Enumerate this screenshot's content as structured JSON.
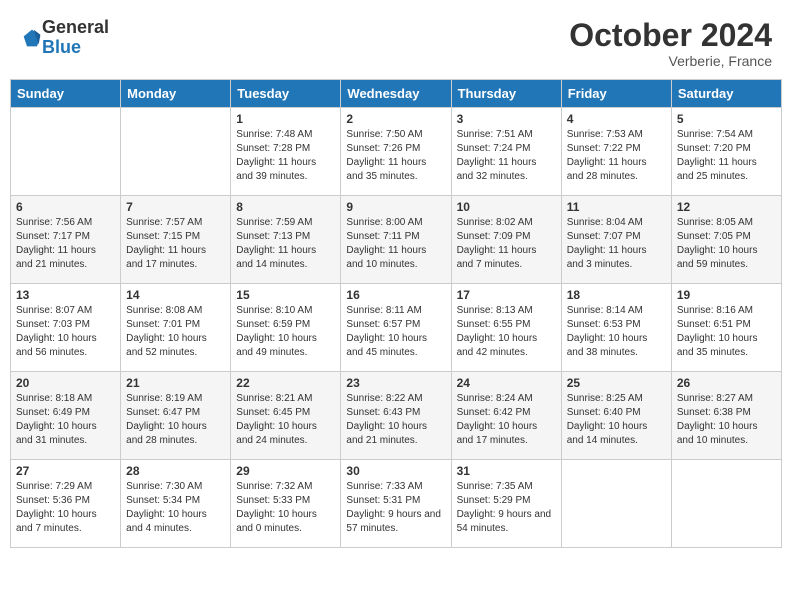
{
  "logo": {
    "general": "General",
    "blue": "Blue"
  },
  "title": {
    "month": "October 2024",
    "location": "Verberie, France"
  },
  "days_of_week": [
    "Sunday",
    "Monday",
    "Tuesday",
    "Wednesday",
    "Thursday",
    "Friday",
    "Saturday"
  ],
  "weeks": [
    [
      {
        "day": "",
        "info": ""
      },
      {
        "day": "",
        "info": ""
      },
      {
        "day": "1",
        "info": "Sunrise: 7:48 AM\nSunset: 7:28 PM\nDaylight: 11 hours and 39 minutes."
      },
      {
        "day": "2",
        "info": "Sunrise: 7:50 AM\nSunset: 7:26 PM\nDaylight: 11 hours and 35 minutes."
      },
      {
        "day": "3",
        "info": "Sunrise: 7:51 AM\nSunset: 7:24 PM\nDaylight: 11 hours and 32 minutes."
      },
      {
        "day": "4",
        "info": "Sunrise: 7:53 AM\nSunset: 7:22 PM\nDaylight: 11 hours and 28 minutes."
      },
      {
        "day": "5",
        "info": "Sunrise: 7:54 AM\nSunset: 7:20 PM\nDaylight: 11 hours and 25 minutes."
      }
    ],
    [
      {
        "day": "6",
        "info": "Sunrise: 7:56 AM\nSunset: 7:17 PM\nDaylight: 11 hours and 21 minutes."
      },
      {
        "day": "7",
        "info": "Sunrise: 7:57 AM\nSunset: 7:15 PM\nDaylight: 11 hours and 17 minutes."
      },
      {
        "day": "8",
        "info": "Sunrise: 7:59 AM\nSunset: 7:13 PM\nDaylight: 11 hours and 14 minutes."
      },
      {
        "day": "9",
        "info": "Sunrise: 8:00 AM\nSunset: 7:11 PM\nDaylight: 11 hours and 10 minutes."
      },
      {
        "day": "10",
        "info": "Sunrise: 8:02 AM\nSunset: 7:09 PM\nDaylight: 11 hours and 7 minutes."
      },
      {
        "day": "11",
        "info": "Sunrise: 8:04 AM\nSunset: 7:07 PM\nDaylight: 11 hours and 3 minutes."
      },
      {
        "day": "12",
        "info": "Sunrise: 8:05 AM\nSunset: 7:05 PM\nDaylight: 10 hours and 59 minutes."
      }
    ],
    [
      {
        "day": "13",
        "info": "Sunrise: 8:07 AM\nSunset: 7:03 PM\nDaylight: 10 hours and 56 minutes."
      },
      {
        "day": "14",
        "info": "Sunrise: 8:08 AM\nSunset: 7:01 PM\nDaylight: 10 hours and 52 minutes."
      },
      {
        "day": "15",
        "info": "Sunrise: 8:10 AM\nSunset: 6:59 PM\nDaylight: 10 hours and 49 minutes."
      },
      {
        "day": "16",
        "info": "Sunrise: 8:11 AM\nSunset: 6:57 PM\nDaylight: 10 hours and 45 minutes."
      },
      {
        "day": "17",
        "info": "Sunrise: 8:13 AM\nSunset: 6:55 PM\nDaylight: 10 hours and 42 minutes."
      },
      {
        "day": "18",
        "info": "Sunrise: 8:14 AM\nSunset: 6:53 PM\nDaylight: 10 hours and 38 minutes."
      },
      {
        "day": "19",
        "info": "Sunrise: 8:16 AM\nSunset: 6:51 PM\nDaylight: 10 hours and 35 minutes."
      }
    ],
    [
      {
        "day": "20",
        "info": "Sunrise: 8:18 AM\nSunset: 6:49 PM\nDaylight: 10 hours and 31 minutes."
      },
      {
        "day": "21",
        "info": "Sunrise: 8:19 AM\nSunset: 6:47 PM\nDaylight: 10 hours and 28 minutes."
      },
      {
        "day": "22",
        "info": "Sunrise: 8:21 AM\nSunset: 6:45 PM\nDaylight: 10 hours and 24 minutes."
      },
      {
        "day": "23",
        "info": "Sunrise: 8:22 AM\nSunset: 6:43 PM\nDaylight: 10 hours and 21 minutes."
      },
      {
        "day": "24",
        "info": "Sunrise: 8:24 AM\nSunset: 6:42 PM\nDaylight: 10 hours and 17 minutes."
      },
      {
        "day": "25",
        "info": "Sunrise: 8:25 AM\nSunset: 6:40 PM\nDaylight: 10 hours and 14 minutes."
      },
      {
        "day": "26",
        "info": "Sunrise: 8:27 AM\nSunset: 6:38 PM\nDaylight: 10 hours and 10 minutes."
      }
    ],
    [
      {
        "day": "27",
        "info": "Sunrise: 7:29 AM\nSunset: 5:36 PM\nDaylight: 10 hours and 7 minutes."
      },
      {
        "day": "28",
        "info": "Sunrise: 7:30 AM\nSunset: 5:34 PM\nDaylight: 10 hours and 4 minutes."
      },
      {
        "day": "29",
        "info": "Sunrise: 7:32 AM\nSunset: 5:33 PM\nDaylight: 10 hours and 0 minutes."
      },
      {
        "day": "30",
        "info": "Sunrise: 7:33 AM\nSunset: 5:31 PM\nDaylight: 9 hours and 57 minutes."
      },
      {
        "day": "31",
        "info": "Sunrise: 7:35 AM\nSunset: 5:29 PM\nDaylight: 9 hours and 54 minutes."
      },
      {
        "day": "",
        "info": ""
      },
      {
        "day": "",
        "info": ""
      }
    ]
  ]
}
